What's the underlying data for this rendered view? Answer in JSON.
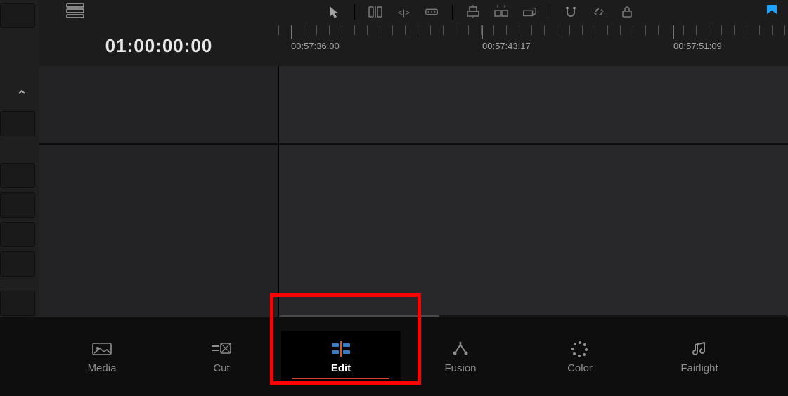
{
  "timecode": "01:00:00:00",
  "ruler": {
    "marks": [
      {
        "pos": 18,
        "label": "00:57:36:00"
      },
      {
        "pos": 290,
        "label": "00:57:43:17"
      },
      {
        "pos": 562,
        "label": "00:57:51:09"
      }
    ]
  },
  "pages": [
    {
      "id": "media",
      "label": "Media",
      "active": false
    },
    {
      "id": "cut",
      "label": "Cut",
      "active": false
    },
    {
      "id": "edit",
      "label": "Edit",
      "active": true
    },
    {
      "id": "fusion",
      "label": "Fusion",
      "active": false
    },
    {
      "id": "color",
      "label": "Color",
      "active": false
    },
    {
      "id": "fairlight",
      "label": "Fairlight",
      "active": false
    }
  ],
  "toolbar_icons": [
    "arrow-pointer",
    "razor-blade",
    "insert-clip",
    "overwrite-clip",
    "replace-clip",
    "ripple-overwrite",
    "fit-to-fill",
    "append-at-end",
    "magnet-snap",
    "link-clips",
    "lock-position"
  ],
  "flag_color": "#1aa3ff"
}
